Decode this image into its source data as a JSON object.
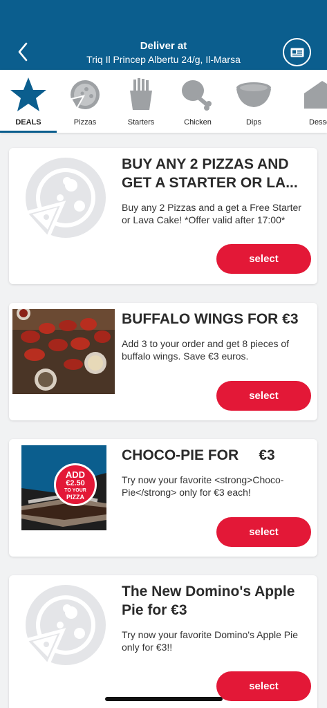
{
  "header": {
    "deliver_label": "Deliver at",
    "address": "Triq Il Princep Albertu 24/g,  Il-Marsa",
    "background_color": "#0b5e8e",
    "back_icon": "chevron-left-icon",
    "account_icon": "id-card-icon"
  },
  "categories": [
    {
      "label": "DEALS",
      "icon": "star-icon",
      "active": true
    },
    {
      "label": "Pizzas",
      "icon": "pizza-icon",
      "active": false
    },
    {
      "label": "Starters",
      "icon": "fries-icon",
      "active": false
    },
    {
      "label": "Chicken",
      "icon": "drumstick-icon",
      "active": false
    },
    {
      "label": "Dips",
      "icon": "dip-bowl-icon",
      "active": false
    },
    {
      "label": "Desserts",
      "icon": "cake-slice-icon",
      "active": false
    }
  ],
  "deals": [
    {
      "title": "BUY ANY 2 PIZZAS AND GET A STARTER OR LA...",
      "description": "Buy any 2 Pizzas and a get a Free Starter or Lava Cake! *Offer valid after 17:00*",
      "button": "select",
      "image": "pizza-placeholder-icon"
    },
    {
      "title": "BUFFALO WINGS FOR €3",
      "description": "Add 3 to your order and get 8 pieces of buffalo wings. Save €3 euros.",
      "button": "select",
      "image": "buffalo-wings-photo"
    },
    {
      "title": "CHOCO-PIE FOR     €3",
      "description": "Try now your favorite <strong>Choco-Pie</strong> only for €3 each!",
      "button": "select",
      "image": "choco-pie-photo",
      "badge": {
        "line1": "ADD",
        "line2": "€2.50",
        "line3": "TO YOUR",
        "line4": "PIZZA"
      }
    },
    {
      "title": "The New Domino's Apple Pie for €3",
      "description": "Try now your favorite Domino's Apple Pie only for €3!!",
      "button": "select",
      "image": "pizza-placeholder-icon"
    }
  ],
  "colors": {
    "accent": "#e31837",
    "brand": "#0b5e8e",
    "icon_gray": "#9ea1a4"
  }
}
